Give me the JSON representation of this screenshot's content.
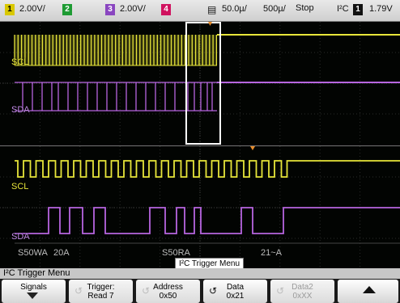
{
  "status": {
    "ch1_number": "1",
    "ch1_scale": "2.00V/",
    "ch2_number": "2",
    "ch3_number": "3",
    "ch3_scale": "2.00V/",
    "ch4_number": "4",
    "time_per_div": "50.0µ/",
    "zoom_time_per_div": "500µ/",
    "run_state": "Stop",
    "trigger_type": "I²C",
    "trigger_source": "1",
    "trigger_level": "1.79V"
  },
  "colors": {
    "ch1": "#e8e63a",
    "ch3": "#b765e0",
    "ch4": "#e0146e",
    "ch2": "#2ab83a"
  },
  "upper": {
    "scl_label": "SCL",
    "sda_label": "SDA"
  },
  "lower": {
    "scl_label": "SCL",
    "sda_label": "SDA",
    "decode": [
      "S50WA",
      "20A",
      "S50RA",
      "21~A"
    ]
  },
  "popup": "I²C Trigger Menu",
  "menu": {
    "title": "I²C Trigger Menu",
    "softkeys": [
      {
        "l1": "Signals",
        "l2": "",
        "icon": "down-arrow-icon"
      },
      {
        "l1": "Trigger:",
        "l2": "Read 7",
        "icon": "entry-knob-icon"
      },
      {
        "l1": "Address",
        "l2": "0x50",
        "icon": "entry-knob-icon"
      },
      {
        "l1": "Data",
        "l2": "0x21",
        "icon": "entry-knob-icon"
      },
      {
        "l1": "Data2",
        "l2": "0xXX",
        "icon": "entry-knob-icon"
      },
      {
        "l1": "",
        "l2": "",
        "icon": "up-arrow-icon"
      }
    ]
  }
}
